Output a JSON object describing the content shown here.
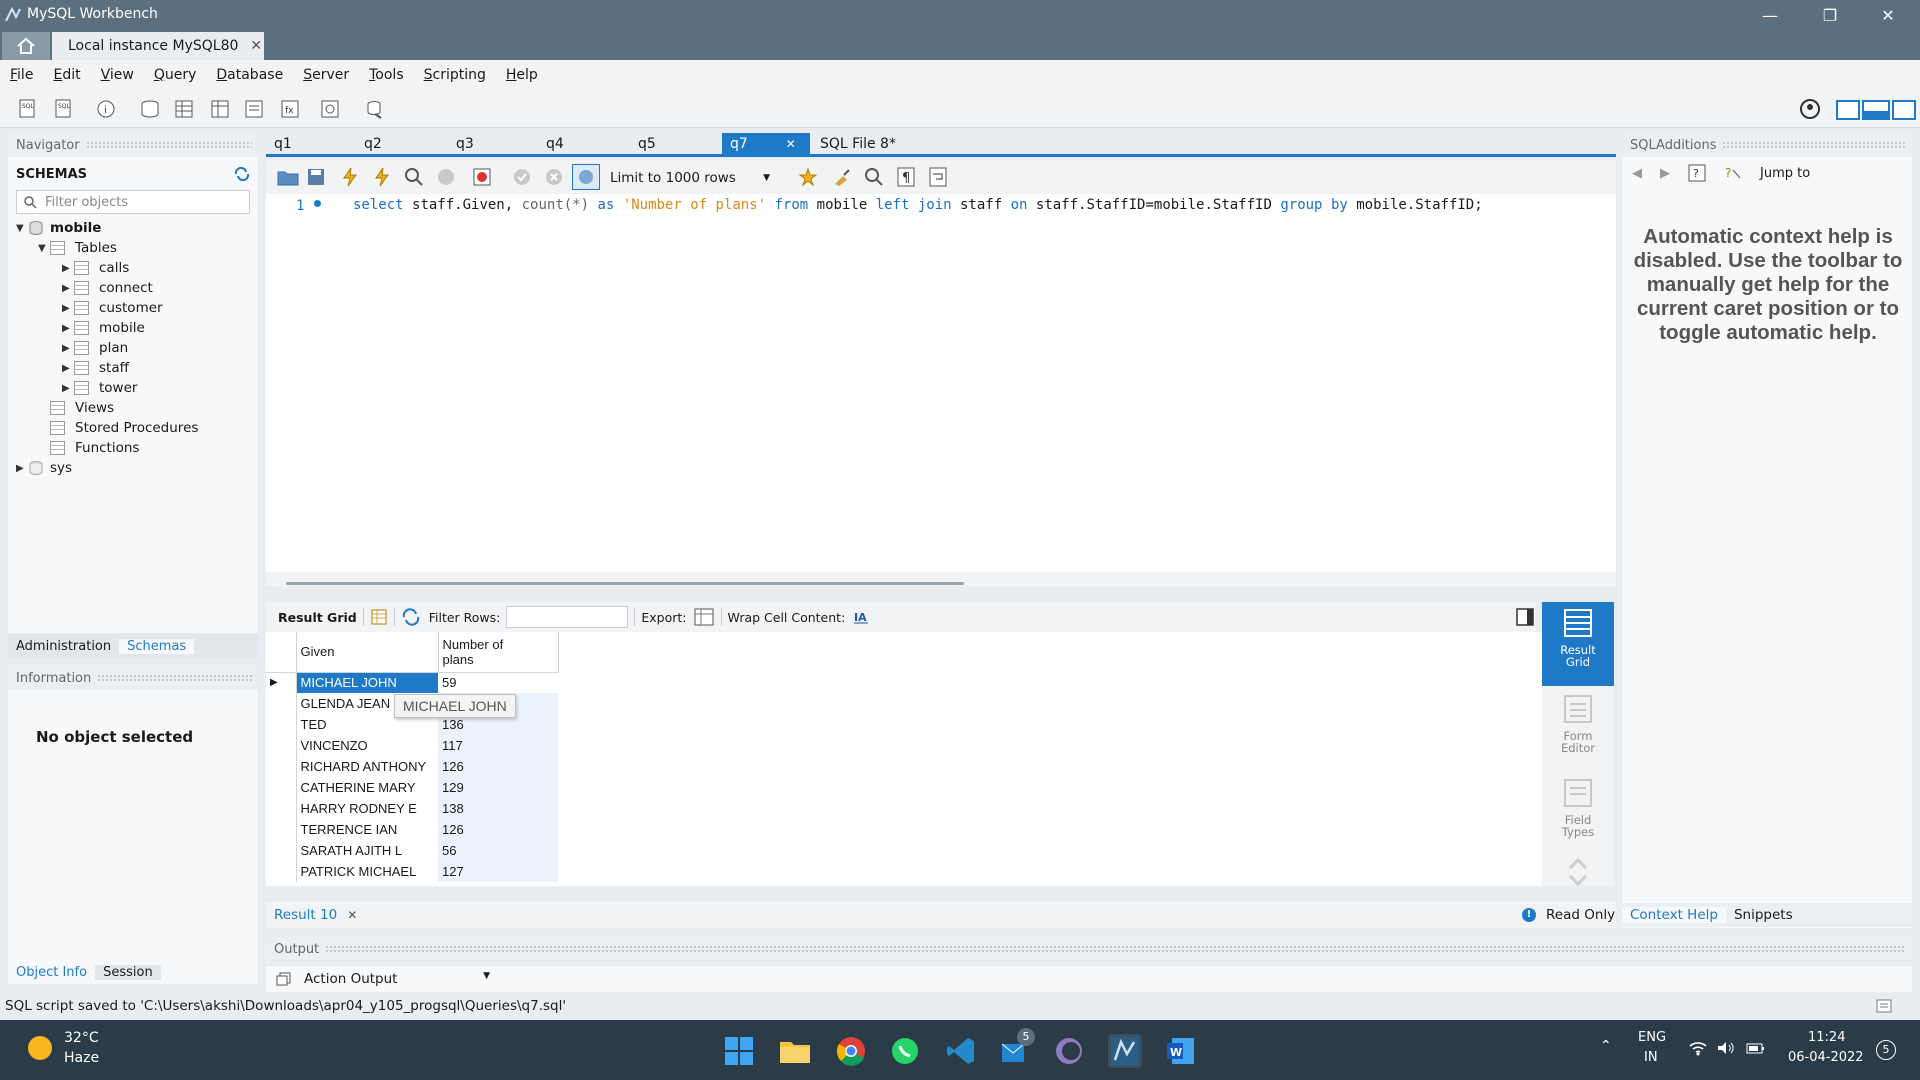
{
  "window": {
    "title": "MySQL Workbench"
  },
  "connection_tab": {
    "label": "Local instance MySQL80"
  },
  "menu": [
    "File",
    "Edit",
    "View",
    "Query",
    "Database",
    "Server",
    "Tools",
    "Scripting",
    "Help"
  ],
  "navigator": {
    "header": "Navigator",
    "schemas_label": "SCHEMAS",
    "filter_placeholder": "Filter objects",
    "schema": "mobile",
    "tables_label": "Tables",
    "tables": [
      "calls",
      "connect",
      "customer",
      "mobile",
      "plan",
      "staff",
      "tower"
    ],
    "other_nodes": [
      "Views",
      "Stored Procedures",
      "Functions"
    ],
    "sys_schema": "sys",
    "tabs": [
      "Administration",
      "Schemas"
    ]
  },
  "information": {
    "header": "Information",
    "empty_text": "No object selected",
    "tabs": [
      "Object Info",
      "Session"
    ]
  },
  "query_tabs": [
    "q1",
    "q2",
    "q3",
    "q4",
    "q5",
    "q7",
    "SQL File 8*"
  ],
  "active_query_tab": "q7",
  "editor": {
    "limit_label": "Limit to 1000 rows",
    "line_number": "1",
    "sql": {
      "select": "select",
      "col1": "staff.Given,",
      "count": "count(*)",
      "as": "as",
      "alias": "'Number of plans'",
      "from": "from",
      "t1": "mobile",
      "left": "left",
      "join": "join",
      "t2": "staff",
      "on": "on",
      "cond": "staff.StaffID=mobile.StaffID",
      "group": "group",
      "by": "by",
      "gcol": "mobile.StaffID;"
    }
  },
  "result_toolbar": {
    "grid_label": "Result Grid",
    "filter_label": "Filter Rows:",
    "export_label": "Export:",
    "wrap_label": "Wrap Cell Content:"
  },
  "result_grid": {
    "columns": [
      "Given",
      "Number of\nplans"
    ],
    "rows": [
      [
        "MICHAEL JOHN",
        "59"
      ],
      [
        "GLENDA JEAN",
        "130"
      ],
      [
        "TED",
        "136"
      ],
      [
        "VINCENZO",
        "117"
      ],
      [
        "RICHARD ANTHONY",
        "126"
      ],
      [
        "CATHERINE MARY",
        "129"
      ],
      [
        "HARRY RODNEY E",
        "138"
      ],
      [
        "TERRENCE IAN",
        "126"
      ],
      [
        "SARATH AJITH L",
        "56"
      ],
      [
        "PATRICK MICHAEL",
        "127"
      ]
    ],
    "tooltip": "MICHAEL JOHN"
  },
  "side_buttons": [
    "Result Grid",
    "Form Editor",
    "Field Types"
  ],
  "result_bottom": {
    "tab_label": "Result 10",
    "read_only": "Read Only"
  },
  "output": {
    "header": "Output",
    "selector": "Action Output"
  },
  "sql_additions": {
    "header": "SQLAdditions",
    "jump_to": "Jump to",
    "help_text": "Automatic context help is disabled. Use the toolbar to manually get help for the current caret position or to toggle automatic help.",
    "tabs": [
      "Context Help",
      "Snippets"
    ]
  },
  "status": {
    "message": "SQL script saved to 'C:\\Users\\akshi\\Downloads\\apr04_y105_progsql\\Queries\\q7.sql'"
  },
  "taskbar": {
    "weather_temp": "32°C",
    "weather_desc": "Haze",
    "lang": "ENG",
    "region": "IN",
    "time": "11:24",
    "date": "06-04-2022",
    "notif_count": "5",
    "badge_count": "5"
  },
  "colors": {
    "accent": "#1e7ac6",
    "titlebar": "#5b6f7e",
    "taskbar": "#2b3b47"
  }
}
